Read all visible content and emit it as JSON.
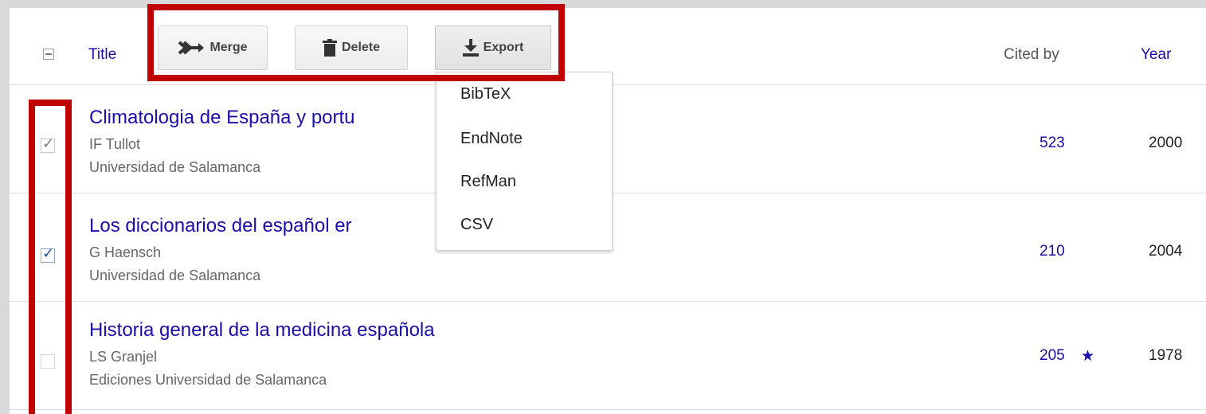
{
  "header": {
    "title_label": "Title",
    "toolbar": {
      "merge_label": "Merge",
      "delete_label": "Delete",
      "export_label": "Export"
    },
    "cited_by_label": "Cited by",
    "year_label": "Year"
  },
  "export_menu": {
    "items": [
      "BibTeX",
      "EndNote",
      "RefMan",
      "CSV"
    ]
  },
  "rows": [
    {
      "title": "Climatologia de España y portu",
      "author": "IF Tullot",
      "publisher": "Universidad de Salamanca",
      "cited_by": "523",
      "year": "2000",
      "checked": true,
      "starred": false
    },
    {
      "title": "Los diccionarios del español er",
      "author": "G Haensch",
      "publisher": "Universidad de Salamanca",
      "cited_by": "210",
      "year": "2004",
      "checked": true,
      "starred": false
    },
    {
      "title": "Historia general de la medicina española",
      "author": "LS Granjel",
      "publisher": "Ediciones Universidad de Salamanca",
      "cited_by": "205",
      "star": "★",
      "year": "1978",
      "checked": false,
      "starred": true
    }
  ],
  "colors": {
    "link": "#1a0dab",
    "highlight": "#c00000",
    "muted_text": "#666666"
  }
}
